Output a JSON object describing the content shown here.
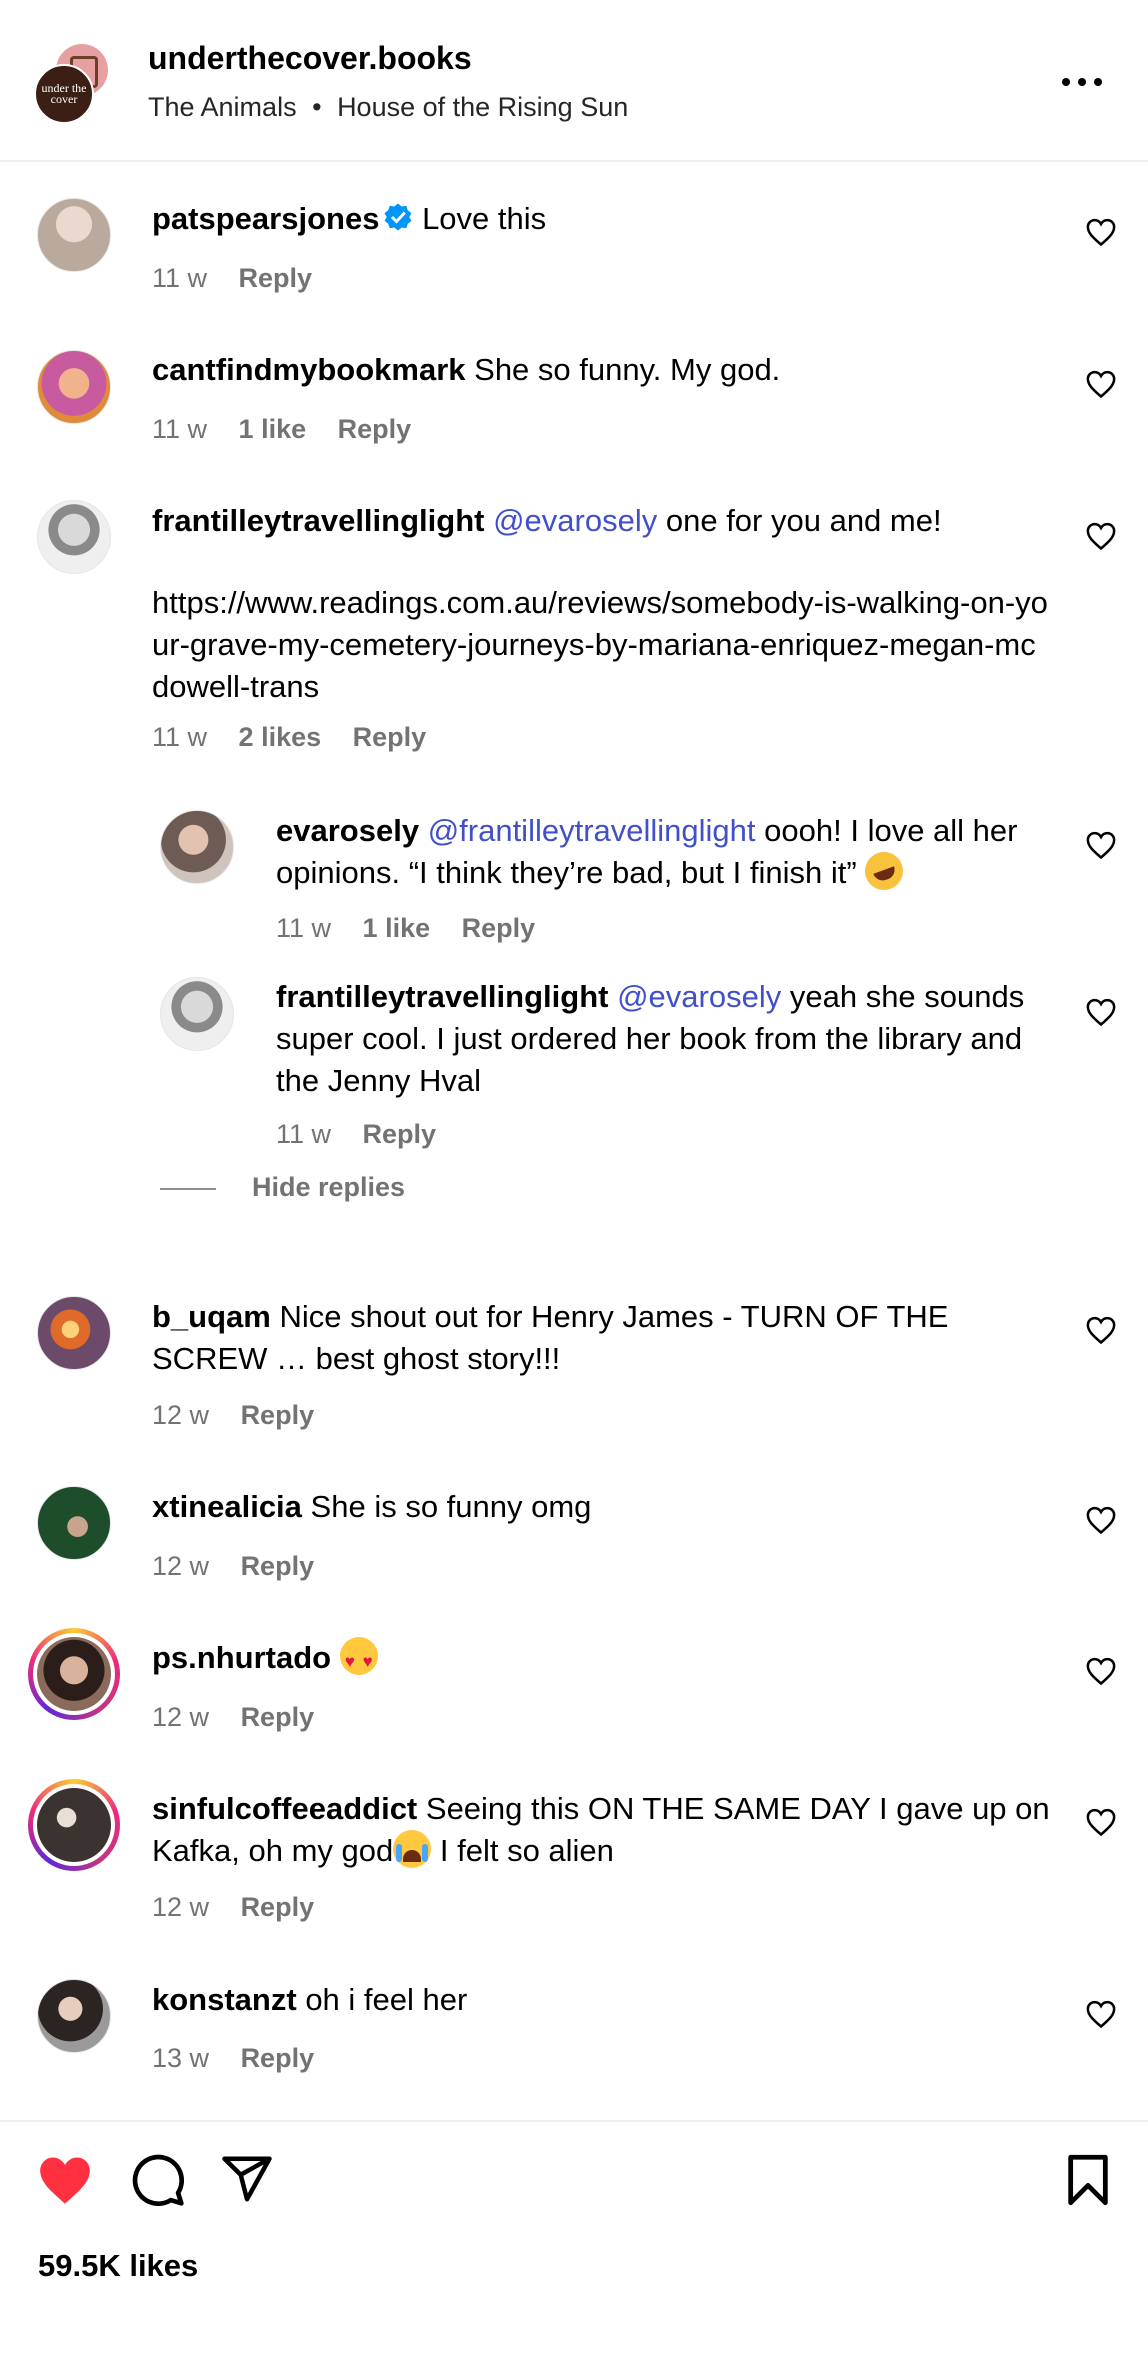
{
  "header": {
    "username": "underthecover.books",
    "audio_artist": "The Animals",
    "separator": "•",
    "audio_title": "House of the Rising Sun",
    "avatar_text": "under the cover",
    "more_icon": "more-horizontal-icon"
  },
  "comments": [
    {
      "username": "patspearsjones",
      "verified": true,
      "parts": [
        {
          "text": "Love this",
          "mention": false
        }
      ],
      "time": "11 w",
      "likes": "",
      "reply": "Reply",
      "avatar_color": "#bdb6ad"
    },
    {
      "username": "cantfindmybookmark",
      "parts": [
        {
          "text": "She so funny. My god.",
          "mention": false
        }
      ],
      "time": "11 w",
      "likes": "1 like",
      "reply": "Reply",
      "avatar_color": "#c85aa0"
    },
    {
      "username": "frantilleytravellinglight",
      "parts": [
        {
          "text": "@evarosely",
          "mention": true
        },
        {
          "text": "one for you and me!",
          "mention": false
        }
      ],
      "link": "https://www.readings.com.au/reviews/somebody-is-walking-on-your-grave-my-cemetery-journeys-by-mariana-enriquez-megan-mcdowell-trans",
      "time": "11 w",
      "likes": "2 likes",
      "reply": "Reply",
      "avatar_color": "#c7c7c7"
    },
    {
      "username": "evarosely",
      "parts": [
        {
          "text": "@frantilleytravellinglight",
          "mention": true
        },
        {
          "text": "oooh! I love all her opinions. “I think they’re bad, but I finish it”",
          "mention": false
        }
      ],
      "emoji": "rolling-on-floor-laughing-emoji",
      "time": "11 w",
      "likes": "1 like",
      "reply": "Reply",
      "avatar_color": "#7d6a62"
    },
    {
      "username": "frantilleytravellinglight",
      "parts": [
        {
          "text": "@evarosely",
          "mention": true
        },
        {
          "text": "yeah she sounds super cool. I just ordered her book from the library and the Jenny Hval",
          "mention": false
        }
      ],
      "time": "11 w",
      "likes": "",
      "reply": "Reply",
      "avatar_color": "#c7c7c7"
    },
    {
      "username": "b_uqam",
      "parts": [
        {
          "text": "Nice shout out for Henry James - TURN OF THE SCREW … best ghost story!!!",
          "mention": false
        }
      ],
      "time": "12 w",
      "likes": "",
      "reply": "Reply",
      "avatar_color": "#e06a2a"
    },
    {
      "username": "xtinealicia",
      "parts": [
        {
          "text": "She is so funny omg",
          "mention": false
        }
      ],
      "time": "12 w",
      "likes": "",
      "reply": "Reply",
      "avatar_color": "#2b6b3d"
    },
    {
      "username": "ps.nhurtado",
      "parts": [],
      "emoji": "heart-eyes-emoji",
      "time": "12 w",
      "likes": "",
      "reply": "Reply",
      "avatar_color": "#8a6a5a"
    },
    {
      "username": "sinfulcoffeeaddict",
      "parts": [
        {
          "text": "Seeing this ON THE SAME DAY I gave up on Kafka, oh my god",
          "mention": false
        }
      ],
      "emoji": "loudly-crying-emoji",
      "tail": "I felt so alien",
      "time": "12 w",
      "likes": "",
      "reply": "Reply",
      "avatar_color": "#3a3330"
    },
    {
      "username": "konstanzt",
      "parts": [
        {
          "text": "oh i feel her",
          "mention": false
        }
      ],
      "time": "13 w",
      "likes": "",
      "reply": "Reply",
      "avatar_color": "#5a5a5a"
    }
  ],
  "hide_replies": "Hide replies",
  "footer": {
    "likes": "59.5K likes",
    "like_icon": "heart-filled-icon",
    "comment_icon": "comment-icon",
    "share_icon": "share-icon",
    "save_icon": "bookmark-icon",
    "like_color": "#ff3040"
  },
  "colors": {
    "mention": "#4150c9",
    "meta": "#737373",
    "verified": "#0095f6"
  }
}
